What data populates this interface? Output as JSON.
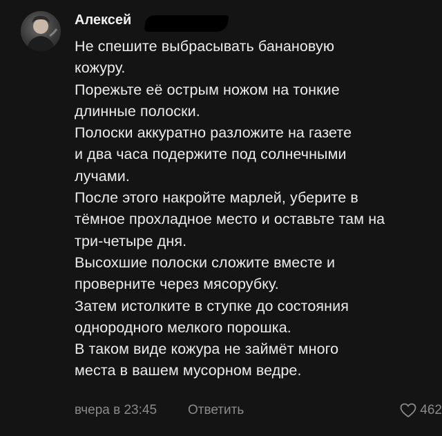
{
  "comment": {
    "author": "Алексей",
    "text": "Не спешите выбрасывать банановую\nкожуру.\nПорежьте её острым ножом на тонкие\nдлинные полоски.\nПолоски аккуратно разложите на газете\nи два часа подержите под солнечными\nлучами.\nПосле этого накройте марлей, уберите в\nтёмное прохладное место и оставьте там на\nтри-четыре дня.\nВысохшие полоски сложите вместе и\nпроверните через мясорубку.\nЗатем истолките в ступке до состояния\nоднородного мелкого порошка.\nВ таком виде кожура не займёт много\nместа в вашем мусорном ведре.",
    "time": "вчера в 23:45",
    "reply_label": "Ответить",
    "likes": "462",
    "avatar_icon": "user-photo-icon",
    "like_icon": "heart-outline-icon"
  }
}
